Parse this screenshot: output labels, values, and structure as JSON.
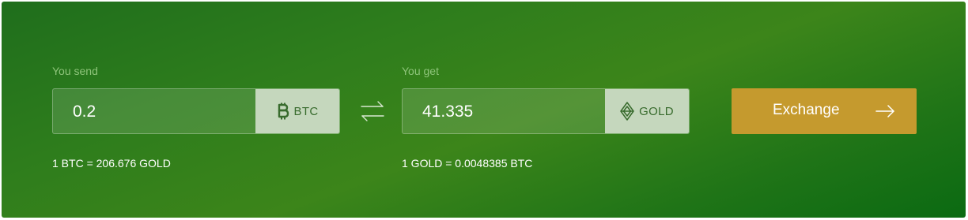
{
  "send": {
    "label": "You send",
    "amount": "0.2",
    "currency": "BTC",
    "currency_icon": "bitcoin-icon",
    "rate": "1 BTC = 206.676 GOLD"
  },
  "get": {
    "label": "You get",
    "amount": "41.335",
    "currency": "GOLD",
    "currency_icon": "gold-diamond-icon",
    "rate": "1 GOLD = 0.0048385 BTC"
  },
  "swap_icon": "swap-arrows-icon",
  "exchange_button": {
    "label": "Exchange",
    "icon": "arrow-right-icon"
  },
  "colors": {
    "panel_green": "#2e7d1c",
    "label_green": "#8ec47a",
    "currency_chip": "#c5d7bd",
    "button_gold": "#c59a2e"
  }
}
